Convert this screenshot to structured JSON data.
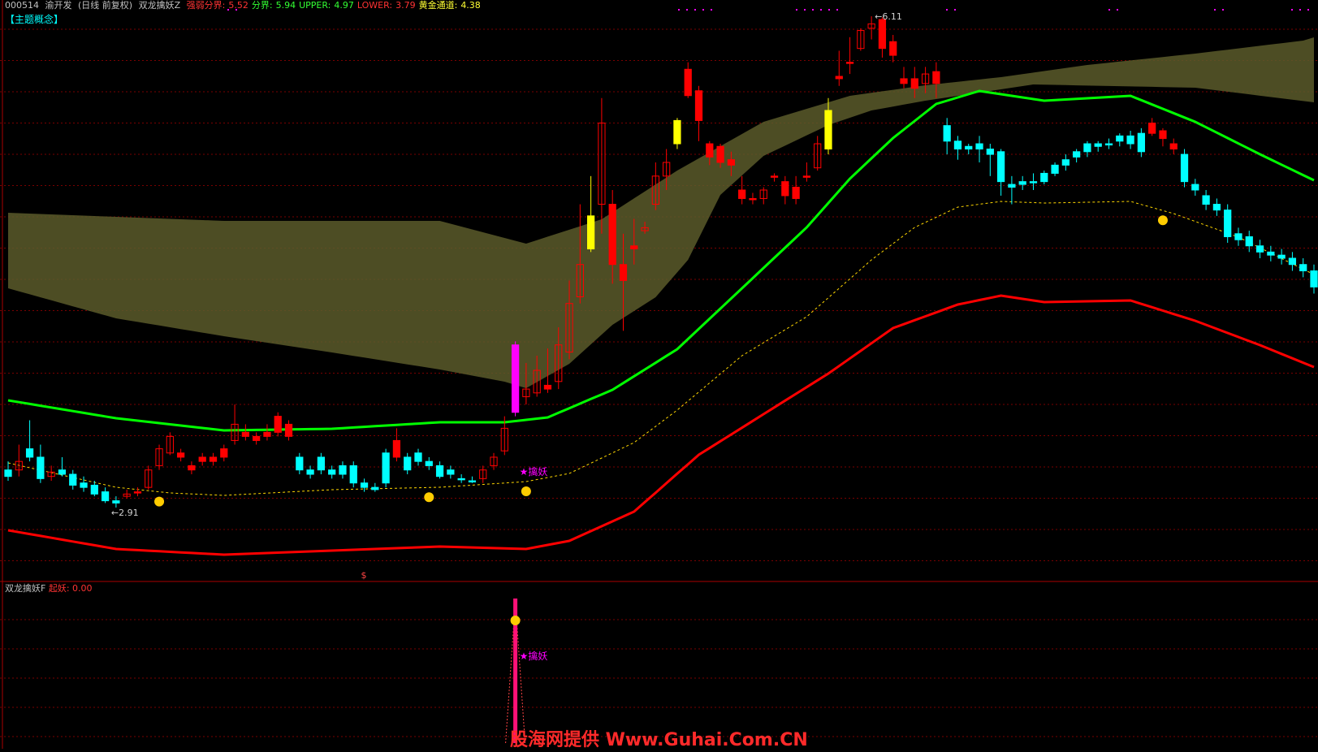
{
  "header": {
    "code": "000514",
    "name": "渝开发",
    "period": "(日线 前复权)",
    "indicator": "双龙擒妖Z",
    "items": [
      {
        "label": "强弱分界:",
        "value": "5.52",
        "color": "#ff3333"
      },
      {
        "label": "分界:",
        "value": "5.94",
        "color": "#33ff33"
      },
      {
        "label": "UPPER:",
        "value": "4.97",
        "color": "#33ff33"
      },
      {
        "label": "LOWER:",
        "value": "3.79",
        "color": "#ff3333"
      },
      {
        "label": "黄金通道:",
        "value": "4.38",
        "color": "#ffff33"
      }
    ]
  },
  "subheader": "【主题概念】",
  "lower_header": {
    "indicator": "双龙擒妖F",
    "label": "起妖:",
    "value": "0.00"
  },
  "annotations": {
    "high": "6.11",
    "low": "2.91",
    "signal": "★擒妖",
    "signal_lower": "★擒妖",
    "dollar": "$"
  },
  "watermark": "股海网提供 Www.Guhai.Com.CN",
  "colors": {
    "up": "#ff0000",
    "down": "#00ffff",
    "upper_line": "#00ff00",
    "lower_line": "#ff0000",
    "band": "#5a5a2a",
    "gold_dash": "#ffd700",
    "special_yellow": "#ffff00",
    "special_magenta": "#ff00ff",
    "grid": "#7a0000"
  },
  "chart_data": {
    "type": "candlestick",
    "y_scale": "log",
    "price_range_visible": [
      2.91,
      6.11
    ],
    "candles": [
      [
        3.05,
        3.08,
        3.12,
        3.03,
        "down"
      ],
      [
        3.08,
        3.12,
        3.2,
        3.05,
        "up"
      ],
      [
        3.18,
        3.14,
        3.32,
        3.12,
        "down"
      ],
      [
        3.14,
        3.04,
        3.2,
        3.02,
        "down"
      ],
      [
        3.05,
        3.07,
        3.1,
        3.03,
        "up"
      ],
      [
        3.08,
        3.06,
        3.14,
        3.05,
        "down"
      ],
      [
        3.06,
        3.01,
        3.08,
        2.99,
        "down"
      ],
      [
        3.02,
        3.0,
        3.05,
        2.98,
        "down"
      ],
      [
        3.01,
        2.97,
        3.03,
        2.96,
        "down"
      ],
      [
        2.98,
        2.94,
        3.0,
        2.93,
        "down"
      ],
      [
        2.94,
        2.93,
        2.96,
        2.91,
        "down"
      ],
      [
        2.96,
        2.97,
        2.99,
        2.95,
        "up"
      ],
      [
        2.98,
        2.98,
        3.0,
        2.96,
        "up"
      ],
      [
        3.0,
        3.08,
        3.1,
        2.99,
        "up"
      ],
      [
        3.1,
        3.18,
        3.2,
        3.08,
        "up"
      ],
      [
        3.16,
        3.24,
        3.26,
        3.15,
        "up"
      ],
      [
        3.16,
        3.14,
        3.18,
        3.12,
        "up"
      ],
      [
        3.1,
        3.08,
        3.12,
        3.06,
        "up"
      ],
      [
        3.14,
        3.12,
        3.16,
        3.1,
        "up"
      ],
      [
        3.14,
        3.12,
        3.16,
        3.1,
        "up"
      ],
      [
        3.18,
        3.14,
        3.2,
        3.12,
        "up"
      ],
      [
        3.22,
        3.3,
        3.4,
        3.2,
        "up"
      ],
      [
        3.26,
        3.24,
        3.3,
        3.22,
        "up"
      ],
      [
        3.24,
        3.22,
        3.26,
        3.2,
        "up"
      ],
      [
        3.26,
        3.24,
        3.3,
        3.22,
        "up"
      ],
      [
        3.34,
        3.26,
        3.36,
        3.24,
        "up"
      ],
      [
        3.3,
        3.24,
        3.32,
        3.22,
        "up"
      ],
      [
        3.14,
        3.08,
        3.16,
        3.06,
        "down"
      ],
      [
        3.08,
        3.06,
        3.1,
        3.04,
        "down"
      ],
      [
        3.08,
        3.14,
        3.16,
        3.06,
        "down"
      ],
      [
        3.08,
        3.06,
        3.1,
        3.04,
        "down"
      ],
      [
        3.06,
        3.1,
        3.12,
        3.04,
        "down"
      ],
      [
        3.1,
        3.02,
        3.12,
        3.0,
        "down"
      ],
      [
        3.02,
        3.0,
        3.04,
        2.98,
        "down"
      ],
      [
        3.0,
        2.99,
        3.02,
        2.98,
        "down"
      ],
      [
        3.02,
        3.16,
        3.18,
        3.0,
        "down"
      ],
      [
        3.22,
        3.14,
        3.28,
        3.12,
        "up"
      ],
      [
        3.14,
        3.08,
        3.16,
        3.06,
        "down"
      ],
      [
        3.12,
        3.16,
        3.18,
        3.1,
        "down"
      ],
      [
        3.12,
        3.1,
        3.14,
        3.08,
        "down"
      ],
      [
        3.1,
        3.05,
        3.12,
        3.04,
        "down"
      ],
      [
        3.08,
        3.06,
        3.1,
        3.04,
        "down"
      ],
      [
        3.04,
        3.04,
        3.06,
        3.02,
        "down"
      ],
      [
        3.03,
        3.03,
        3.05,
        3.02,
        "down"
      ],
      [
        3.04,
        3.08,
        3.1,
        3.02,
        "up"
      ],
      [
        3.1,
        3.14,
        3.16,
        3.08,
        "up"
      ],
      [
        3.17,
        3.28,
        3.34,
        3.15,
        "up"
      ],
      [
        3.36,
        3.72,
        3.74,
        3.34,
        "special_magenta"
      ],
      [
        3.44,
        3.48,
        3.62,
        3.4,
        "up"
      ],
      [
        3.46,
        3.58,
        3.66,
        3.44,
        "up"
      ],
      [
        3.5,
        3.48,
        3.7,
        3.46,
        "up"
      ],
      [
        3.52,
        3.72,
        3.82,
        3.48,
        "up"
      ],
      [
        3.68,
        3.96,
        4.1,
        3.64,
        "up"
      ],
      [
        4.0,
        4.2,
        4.6,
        3.96,
        "up"
      ],
      [
        4.3,
        4.52,
        4.8,
        4.28,
        "special_yellow"
      ],
      [
        4.6,
        5.2,
        5.4,
        4.4,
        "up"
      ],
      [
        4.6,
        4.2,
        4.7,
        4.08,
        "up"
      ],
      [
        4.2,
        4.1,
        4.4,
        3.8,
        "up"
      ],
      [
        4.32,
        4.3,
        4.5,
        4.2,
        "up"
      ],
      [
        4.42,
        4.44,
        4.48,
        4.4,
        "up"
      ],
      [
        4.6,
        4.8,
        4.9,
        4.56,
        "up"
      ],
      [
        4.8,
        4.9,
        5.0,
        4.7,
        "up"
      ],
      [
        5.04,
        5.22,
        5.24,
        5.0,
        "special_yellow"
      ],
      [
        5.64,
        5.42,
        5.7,
        5.4,
        "up"
      ],
      [
        5.46,
        5.22,
        5.5,
        5.06,
        "up"
      ],
      [
        5.04,
        4.94,
        5.06,
        4.88,
        "up"
      ],
      [
        5.02,
        4.9,
        5.04,
        4.86,
        "up"
      ],
      [
        4.92,
        4.88,
        4.98,
        4.8,
        "up"
      ],
      [
        4.7,
        4.64,
        4.8,
        4.6,
        "up"
      ],
      [
        4.64,
        4.64,
        4.68,
        4.6,
        "up"
      ],
      [
        4.64,
        4.7,
        4.72,
        4.6,
        "up"
      ],
      [
        4.8,
        4.8,
        4.82,
        4.76,
        "up"
      ],
      [
        4.76,
        4.66,
        4.8,
        4.6,
        "up"
      ],
      [
        4.72,
        4.64,
        4.8,
        4.6,
        "up"
      ],
      [
        4.8,
        4.8,
        4.9,
        4.76,
        "up"
      ],
      [
        4.86,
        5.04,
        5.1,
        4.84,
        "up"
      ],
      [
        5.3,
        5.0,
        5.4,
        4.96,
        "special_yellow"
      ],
      [
        5.58,
        5.56,
        5.8,
        5.5,
        "up"
      ],
      [
        5.7,
        5.7,
        5.92,
        5.6,
        "up"
      ],
      [
        5.82,
        5.98,
        6.0,
        5.8,
        "up"
      ],
      [
        6.0,
        6.04,
        6.11,
        5.9,
        "up"
      ],
      [
        6.08,
        5.82,
        6.1,
        5.74,
        "up"
      ],
      [
        5.88,
        5.76,
        5.94,
        5.7,
        "up"
      ],
      [
        5.56,
        5.52,
        5.66,
        5.48,
        "up"
      ],
      [
        5.56,
        5.48,
        5.66,
        5.4,
        "up"
      ],
      [
        5.52,
        5.6,
        5.66,
        5.44,
        "up"
      ],
      [
        5.62,
        5.52,
        5.7,
        5.4,
        "up"
      ],
      [
        5.18,
        5.06,
        5.24,
        4.96,
        "down"
      ],
      [
        5.06,
        5.0,
        5.1,
        4.92,
        "down"
      ],
      [
        5.02,
        5.0,
        5.04,
        4.96,
        "down"
      ],
      [
        5.0,
        5.04,
        5.1,
        4.9,
        "down"
      ],
      [
        5.0,
        4.96,
        5.04,
        4.8,
        "down"
      ],
      [
        4.98,
        4.76,
        5.0,
        4.66,
        "down"
      ],
      [
        4.72,
        4.74,
        4.8,
        4.6,
        "down"
      ],
      [
        4.74,
        4.76,
        4.8,
        4.7,
        "down"
      ],
      [
        4.76,
        4.76,
        4.82,
        4.7,
        "down"
      ],
      [
        4.76,
        4.82,
        4.84,
        4.74,
        "down"
      ],
      [
        4.82,
        4.88,
        4.9,
        4.8,
        "down"
      ],
      [
        4.88,
        4.92,
        4.96,
        4.84,
        "down"
      ],
      [
        4.94,
        4.98,
        5.0,
        4.9,
        "down"
      ],
      [
        4.98,
        5.04,
        5.06,
        4.94,
        "down"
      ],
      [
        5.04,
        5.02,
        5.06,
        4.98,
        "down"
      ],
      [
        5.04,
        5.04,
        5.08,
        5.0,
        "down"
      ],
      [
        5.06,
        5.1,
        5.12,
        5.02,
        "down"
      ],
      [
        5.1,
        5.04,
        5.14,
        5.0,
        "down"
      ],
      [
        5.12,
        4.98,
        5.16,
        4.94,
        "down"
      ],
      [
        5.2,
        5.12,
        5.24,
        5.1,
        "up"
      ],
      [
        5.14,
        5.08,
        5.16,
        5.02,
        "up"
      ],
      [
        5.04,
        5.0,
        5.08,
        4.96,
        "up"
      ],
      [
        4.96,
        4.76,
        5.0,
        4.72,
        "down"
      ],
      [
        4.74,
        4.7,
        4.78,
        4.66,
        "down"
      ],
      [
        4.66,
        4.6,
        4.7,
        4.56,
        "down"
      ],
      [
        4.6,
        4.56,
        4.64,
        4.52,
        "down"
      ],
      [
        4.56,
        4.38,
        4.6,
        4.34,
        "down"
      ],
      [
        4.4,
        4.36,
        4.44,
        4.32,
        "down"
      ],
      [
        4.38,
        4.32,
        4.42,
        4.28,
        "down"
      ],
      [
        4.32,
        4.28,
        4.36,
        4.24,
        "down"
      ],
      [
        4.28,
        4.26,
        4.32,
        4.22,
        "down"
      ],
      [
        4.26,
        4.24,
        4.3,
        4.2,
        "down"
      ],
      [
        4.24,
        4.2,
        4.28,
        4.16,
        "down"
      ],
      [
        4.2,
        4.16,
        4.24,
        4.12,
        "down"
      ],
      [
        4.16,
        4.06,
        4.2,
        4.02,
        "down"
      ]
    ]
  }
}
